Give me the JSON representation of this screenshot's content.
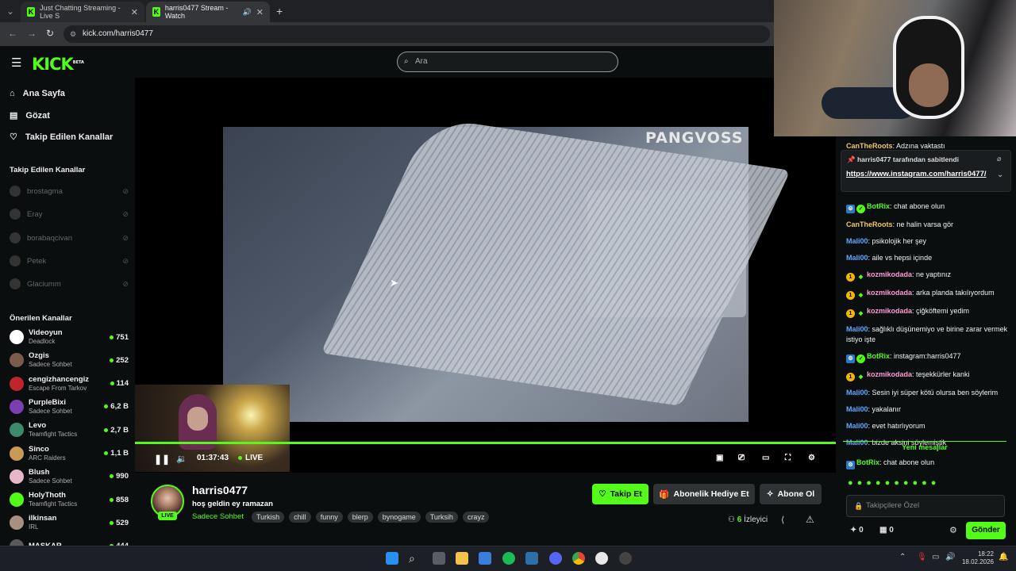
{
  "browser": {
    "tabs": [
      {
        "title": "Just Chatting Streaming - Live S"
      },
      {
        "title": "harris0477 Stream - Watch"
      }
    ],
    "url": "kick.com/harris0477"
  },
  "header": {
    "logo": "KICK",
    "logo_badge": "BETA",
    "search_placeholder": "Ara"
  },
  "sidebar": {
    "nav": [
      {
        "label": "Ana Sayfa",
        "icon": "home-icon"
      },
      {
        "label": "Gözat",
        "icon": "browse-icon"
      },
      {
        "label": "Takip Edilen Kanallar",
        "icon": "heart-icon"
      }
    ],
    "following_title": "Takip Edilen Kanallar",
    "following": [
      {
        "name": "brostagma"
      },
      {
        "name": "Eray"
      },
      {
        "name": "borabaqcivan"
      },
      {
        "name": "Petek"
      },
      {
        "name": "Glaciumm"
      }
    ],
    "recommended_title": "Önerilen Kanallar",
    "recommended": [
      {
        "name": "Videoyun",
        "category": "Deadlock",
        "viewers": "751",
        "color": "#ffffff"
      },
      {
        "name": "Ozgis",
        "category": "Sadece Sohbet",
        "viewers": "252",
        "color": "#7a5b4e"
      },
      {
        "name": "cengizhancengiz",
        "category": "Escape From Tarkov",
        "viewers": "114",
        "color": "#c0242c"
      },
      {
        "name": "PurpleBixi",
        "category": "Sadece Sohbet",
        "viewers": "6,2 B",
        "color": "#7b3fb0"
      },
      {
        "name": "Levo",
        "category": "Teamfight Tactics",
        "viewers": "2,7 B",
        "color": "#3a8a6b"
      },
      {
        "name": "Sinco",
        "category": "ARC Raiders",
        "viewers": "1,1 B",
        "color": "#c79a55"
      },
      {
        "name": "Blush",
        "category": "Sadece Sohbet",
        "viewers": "990",
        "color": "#e7b6c8"
      },
      {
        "name": "HolyThoth",
        "category": "Teamfight Tactics",
        "viewers": "858",
        "color": "#53fc18"
      },
      {
        "name": "ilkinsan",
        "category": "IRL",
        "viewers": "529",
        "color": "#a89080"
      },
      {
        "name": "MASKAR",
        "category": "",
        "viewers": "444",
        "color": "#5a5a5a"
      }
    ]
  },
  "player": {
    "watermark": "PANGVOSS",
    "progress": 1.0,
    "time": "01:37:43",
    "live_label": "LIVE"
  },
  "channel": {
    "name": "harris0477",
    "live_badge": "LIVE",
    "title": "hoş geldin ey ramazan",
    "category": "Sadece Sohbet",
    "tags": [
      "Turkish",
      "chill",
      "funny",
      "blerp",
      "bynogame",
      "Turksih",
      "crayz"
    ],
    "follow_label": "Takip Et",
    "gift_label": "Abonelik Hediye Et",
    "subscribe_label": "Abone Ol",
    "viewers_count": "6",
    "viewers_label": "İzleyici"
  },
  "chat": {
    "clipped_user": "CanTheRoots",
    "clipped_text": "Adzına vaktastı",
    "pinned_by": "harris0477 tarafından sabitlendi",
    "pinned_link": "https://www.instagram.com/harris0477/",
    "messages": [
      {
        "user": "BotRix",
        "text": "chat abone olun",
        "color": "#53fc18",
        "badges": [
          "bot"
        ]
      },
      {
        "user": "CanTheRoots",
        "text": "ne halin varsa gör",
        "color": "#f2c75c",
        "badges": []
      },
      {
        "user": "Mali00",
        "text": "psikolojik her şey",
        "color": "#5ea8ff",
        "badges": []
      },
      {
        "user": "Mali00",
        "text": "aile vs hepsi içinde",
        "color": "#5ea8ff",
        "badges": []
      },
      {
        "user": "kozmikodada",
        "text": "ne yaptınız",
        "color": "#ff9ad5",
        "badges": [
          "sub"
        ]
      },
      {
        "user": "kozmikodada",
        "text": "arka planda takılıyordum",
        "color": "#ff9ad5",
        "badges": [
          "sub"
        ]
      },
      {
        "user": "kozmikodada",
        "text": "çiğköftemi yedim",
        "color": "#ff9ad5",
        "badges": [
          "sub"
        ]
      },
      {
        "user": "Mali00",
        "text": "sağlıklı düşünemiyo ve birine zarar vermek istiyo işte",
        "color": "#5ea8ff",
        "badges": []
      },
      {
        "user": "BotRix",
        "text": "instagram:harris0477",
        "color": "#53fc18",
        "badges": [
          "bot"
        ]
      },
      {
        "user": "kozmikodada",
        "text": "teşekkürler kanki",
        "color": "#ff9ad5",
        "badges": [
          "sub"
        ]
      },
      {
        "user": "Mali00",
        "text": "Sesin iyi süper kötü olursa ben söylerim",
        "color": "#5ea8ff",
        "badges": []
      },
      {
        "user": "Mali00",
        "text": "yakalanır",
        "color": "#5ea8ff",
        "badges": []
      },
      {
        "user": "Mali00",
        "text": "evet hatırlıyorum",
        "color": "#5ea8ff",
        "badges": []
      },
      {
        "user": "Mali00",
        "text": "bizde aksini söylemiştik",
        "color": "#5ea8ff",
        "badges": []
      }
    ],
    "new_messages_label": "Yeni mesajlar",
    "last_message": {
      "user": "BotRix",
      "text": "chat abone olun",
      "color": "#53fc18"
    },
    "input_placeholder": "Takipçilere Özel",
    "points": "0",
    "gifts": "0",
    "send_label": "Gönder"
  },
  "taskbar": {
    "time": "18:22",
    "date": "18.02.2026"
  },
  "colors": {
    "accent": "#53fc18",
    "background": "#0b0e0f"
  }
}
